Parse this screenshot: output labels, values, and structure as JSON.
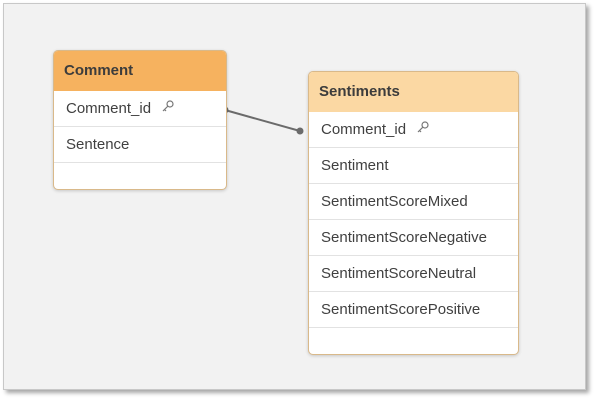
{
  "colors": {
    "comment_header": "#f6b25f",
    "sentiments_header": "#fbd8a3",
    "canvas": "#f2f2f2",
    "link_line": "#6b6b6b"
  },
  "tables": {
    "comment": {
      "title": "Comment",
      "fields": [
        "Comment_id",
        "Sentence"
      ]
    },
    "sentiments": {
      "title": "Sentiments",
      "fields": [
        "Comment_id",
        "Sentiment",
        "SentimentScoreMixed",
        "SentimentScoreNegative",
        "SentimentScoreNeutral",
        "SentimentScorePositive"
      ]
    }
  },
  "icons": {
    "key_field": "key-icon"
  }
}
